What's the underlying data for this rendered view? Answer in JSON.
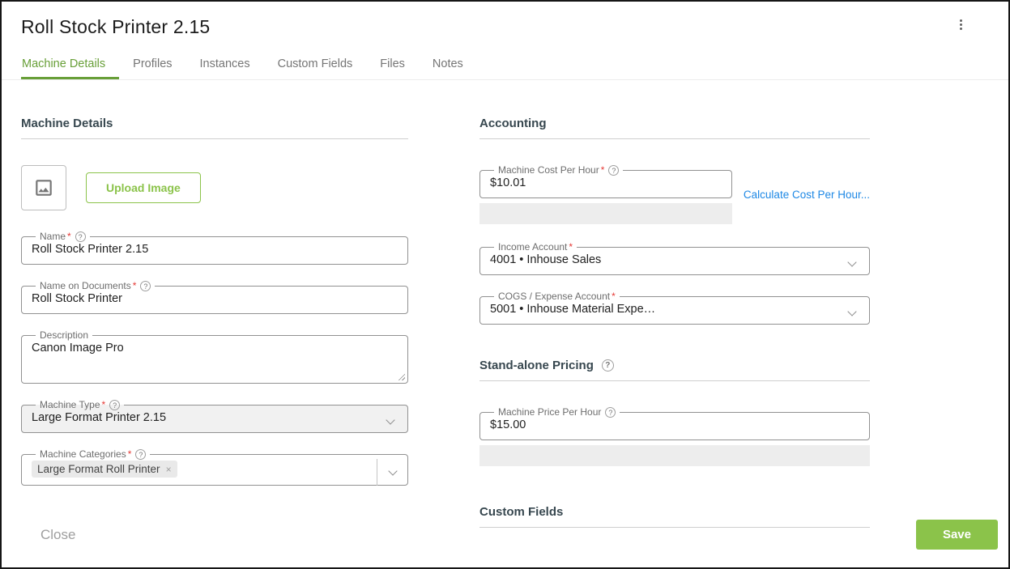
{
  "window": {
    "title": "Roll Stock Printer 2.15"
  },
  "tabs": [
    {
      "label": "Machine Details"
    },
    {
      "label": "Profiles"
    },
    {
      "label": "Instances"
    },
    {
      "label": "Custom Fields"
    },
    {
      "label": "Files"
    },
    {
      "label": "Notes"
    }
  ],
  "machine_details": {
    "section_title": "Machine Details",
    "upload_image_label": "Upload Image",
    "name": {
      "label": "Name",
      "value": "Roll Stock Printer 2.15"
    },
    "name_on_documents": {
      "label": "Name on Documents",
      "value": "Roll Stock Printer"
    },
    "description": {
      "label": "Description",
      "value": "Canon Image Pro"
    },
    "machine_type": {
      "label": "Machine Type",
      "value": "Large Format Printer 2.15"
    },
    "machine_categories": {
      "label": "Machine Categories",
      "selected_chip": "Large Format Roll Printer"
    }
  },
  "accounting": {
    "section_title": "Accounting",
    "machine_cost_per_hour": {
      "label": "Machine Cost Per Hour",
      "value": "$10.01"
    },
    "calculate_link": "Calculate Cost Per Hour...",
    "income_account": {
      "label": "Income Account",
      "value": "4001 • Inhouse Sales"
    },
    "cogs_expense_account": {
      "label": "COGS / Expense Account",
      "value": "5001 • Inhouse Material Expe…"
    }
  },
  "standalone_pricing": {
    "section_title": "Stand-alone Pricing",
    "machine_price_per_hour": {
      "label": "Machine Price Per Hour",
      "value": "$15.00"
    }
  },
  "custom_fields": {
    "section_title": "Custom Fields"
  },
  "footer": {
    "close_label": "Close",
    "save_label": "Save"
  },
  "colors": {
    "accent_green": "#689f38",
    "save_green": "#8bc34a",
    "link_blue": "#1e88e5",
    "required_red": "#e53935"
  }
}
